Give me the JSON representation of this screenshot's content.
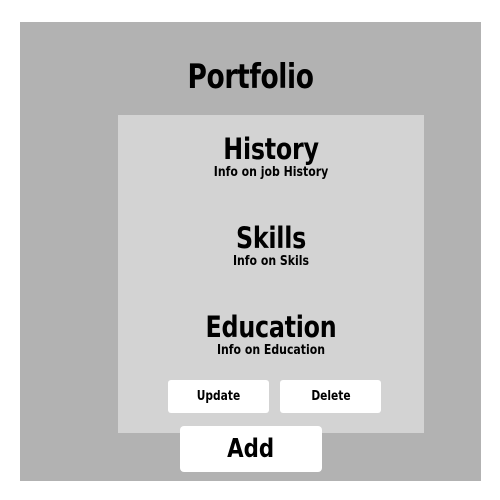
{
  "page": {
    "title": "Portfolio"
  },
  "sections": {
    "history": {
      "title": "History",
      "info": "Info on job History"
    },
    "skills": {
      "title": "Skills",
      "info": "Info on Skils"
    },
    "education": {
      "title": "Education",
      "info": "Info on Education"
    }
  },
  "actions": {
    "update_label": "Update",
    "delete_label": "Delete",
    "add_label": "Add"
  },
  "colors": {
    "frame_background": "#b2b2b2",
    "panel_background": "#d3d3d3",
    "button_background": "#ffffff",
    "text": "#000000"
  }
}
